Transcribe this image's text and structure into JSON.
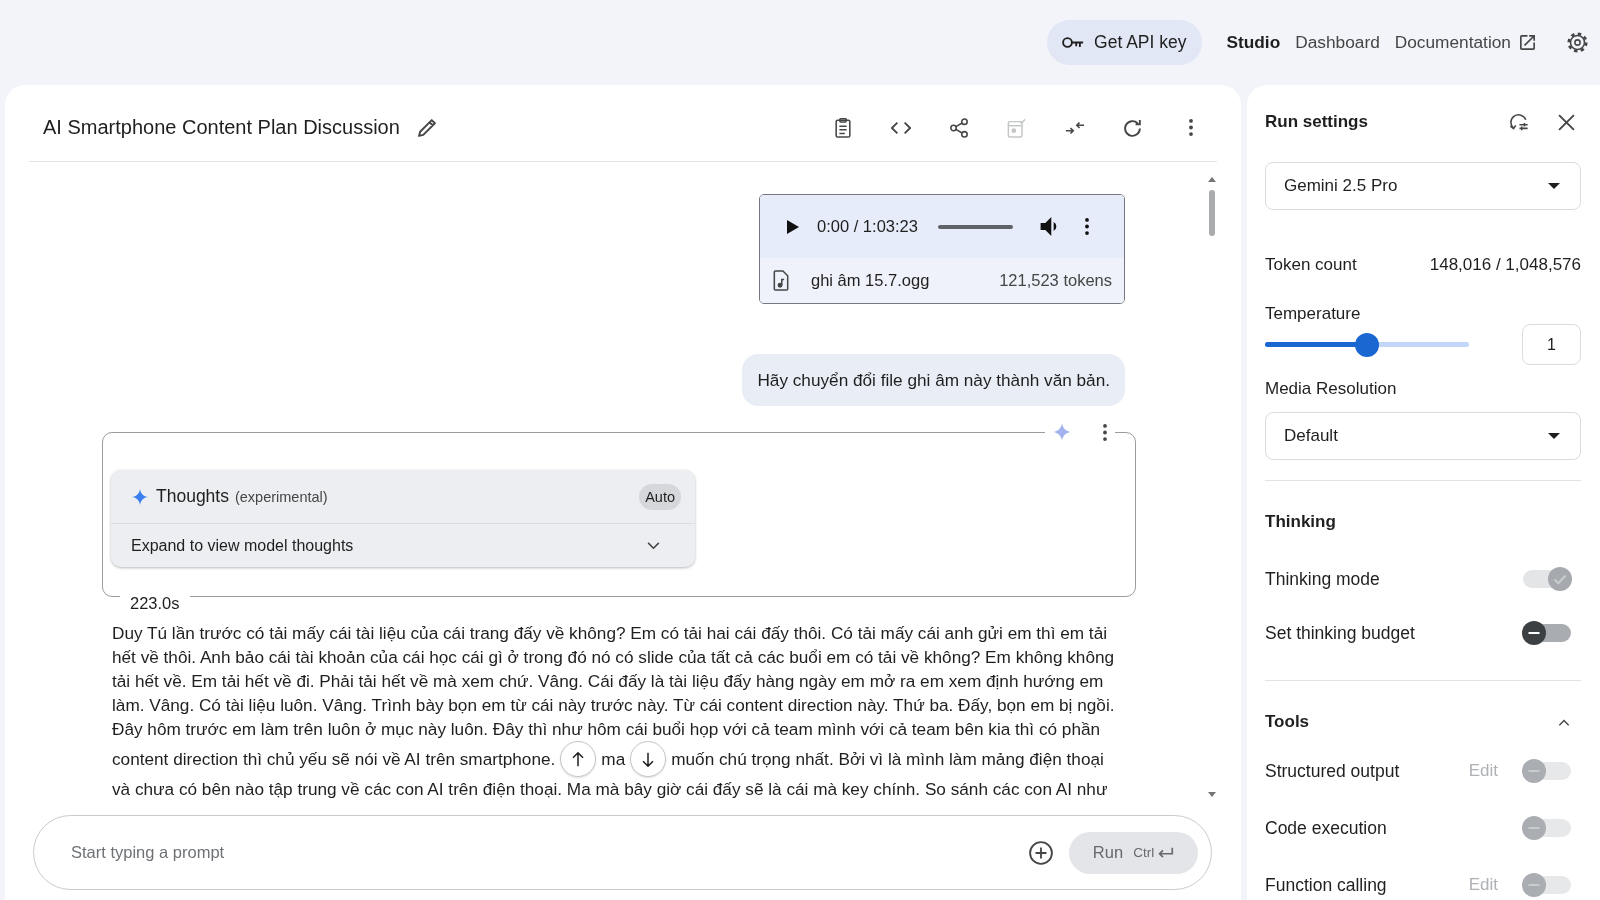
{
  "top_bar": {
    "api_button": "Get API key",
    "nav": [
      {
        "label": "Studio",
        "selected": true,
        "external": false
      },
      {
        "label": "Dashboard",
        "selected": false,
        "external": false
      },
      {
        "label": "Documentation",
        "selected": false,
        "external": true
      }
    ]
  },
  "chat": {
    "title": "AI Smartphone Content Plan Discussion",
    "toolbar_buttons": [
      {
        "disabled": false
      },
      {
        "disabled": false
      },
      {
        "disabled": false
      },
      {
        "disabled": true
      },
      {
        "disabled": false
      },
      {
        "disabled": false
      },
      {
        "disabled": false
      }
    ],
    "attachment": {
      "time": "0:00 / 1:03:23",
      "file_name": "ghi âm 15.7.ogg",
      "tokens": "121,523 tokens"
    },
    "user_message": "Hãy chuyển đổi file ghi âm này thành văn bản.",
    "response": {
      "thoughts": {
        "title": "Thoughts",
        "note": "(experimental)",
        "badge": "Auto",
        "expand_label": "Expand to view model thoughts",
        "expanded": false
      },
      "duration": "223.0s",
      "lines": [
        [
          "Duy Tú lần trước có tải mấy cái tài liệu của cái trang đấy về không? Em có tải hai cái đấy thôi. Có tải mấy cái anh gửi em thì em tải"
        ],
        [
          "hết về thôi. Anh bảo cái tài khoản của cái học cái gì ở trong đó nó có slide của tất cả các buổi em có tải về không? Em không không"
        ],
        [
          "tải hết về. Em tải hết về đi. Phải tải hết về mà xem chứ. Vâng. Cái đấy là tài liệu đấy hàng ngày em mở ra em xem định hướng em"
        ],
        [
          "làm. Vâng. Có tài liệu luôn. Vâng. Trình bày bọn em từ cái này trước này. Từ cái content direction này. Thứ ba. Đấy, bọn em bị ngồi."
        ],
        [
          "Đây hôm trước em làm trên luôn ở mục này luôn. Đây thì như hôm cái buổi họp với cả team mình với cả team bên kia thì có phần"
        ],
        [
          "content direction thì chủ yếu sẽ nói về AI trên smartphone.",
          "ma",
          "muốn chú trọng nhất. Bởi vì là mình làm mảng điện thoại"
        ],
        [
          "và chưa có bên nào tập trung về các con AI trên điện thoại. Ma mà bây giờ cái đấy sẽ là cái mà key chính. So sánh các con AI như"
        ]
      ]
    },
    "prompt": {
      "placeholder": "Start typing a prompt",
      "run_label": "Run",
      "shortcut": "Ctrl",
      "disabled": true
    }
  },
  "run_settings": {
    "title": "Run settings",
    "model": "Gemini 2.5 Pro",
    "token_count": {
      "label": "Token count",
      "value": "148,016 / 1,048,576"
    },
    "temperature": {
      "label": "Temperature",
      "level": 0.5,
      "value": "1"
    },
    "media_resolution": {
      "label": "Media Resolution",
      "value": "Default"
    },
    "sections": [
      {
        "title": "Thinking",
        "rows": [
          {
            "label": "Thinking mode",
            "on": true,
            "disabled": true
          },
          {
            "label": "Set thinking budget",
            "on": false,
            "disabled": false
          }
        ]
      },
      {
        "title": "Tools",
        "expanded": true,
        "rows": [
          {
            "label": "Structured output",
            "action": "Edit",
            "on": false,
            "disabled": true
          },
          {
            "label": "Code execution",
            "on": false,
            "disabled": true
          },
          {
            "label": "Function calling",
            "action": "Edit",
            "on": false,
            "disabled": true
          }
        ]
      }
    ]
  }
}
